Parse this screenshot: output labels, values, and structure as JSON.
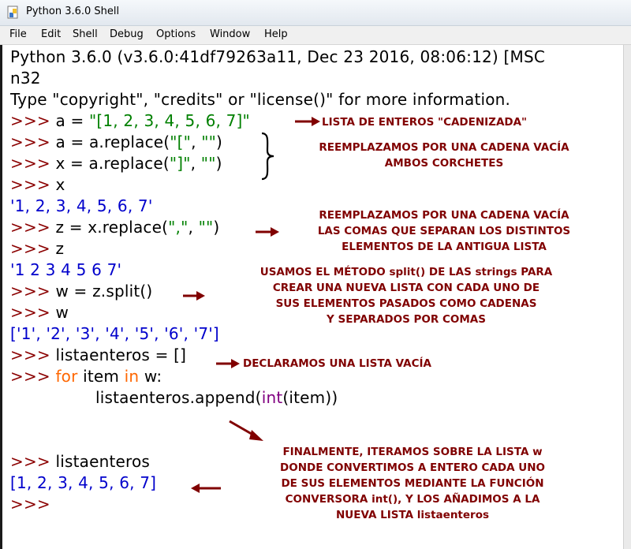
{
  "window": {
    "title": "Python 3.6.0 Shell"
  },
  "menu": [
    "File",
    "Edit",
    "Shell",
    "Debug",
    "Options",
    "Window",
    "Help"
  ],
  "shell": {
    "banner1": "Python 3.6.0 (v3.6.0:41df79263a11, Dec 23 2016, 08:06:12) [MSC",
    "banner2": "n32",
    "banner3": "Type \"copyright\", \"credits\" or \"license()\" for more information.",
    "prompt": ">>> ",
    "l4_code": "a = ",
    "l4_str": "\"[1, 2, 3, 4, 5, 6, 7]\"",
    "l5_a": "a = a.replace(",
    "l5_s1": "\"[\"",
    "l5_b": ", ",
    "l5_s2": "\"\"",
    "l5_c": ")",
    "l6_a": "x = a.replace(",
    "l6_s1": "\"]\"",
    "l6_b": ", ",
    "l6_s2": "\"\"",
    "l6_c": ")",
    "l7_code": "x",
    "l8_out": "'1, 2, 3, 4, 5, 6, 7'",
    "l9_a": "z = x.replace(",
    "l9_s1": "\",\"",
    "l9_b": ", ",
    "l9_s2": "\"\"",
    "l9_c": ")",
    "l10_code": "z",
    "l11_out": "'1 2 3 4 5 6 7'",
    "l12_code": "w = z.split()",
    "l13_code": "w",
    "l14_out": "['1', '2', '3', '4', '5', '6', '7']",
    "l15_code": "listaenteros = []",
    "l16_kw1": "for",
    "l16_mid": " item ",
    "l16_kw2": "in",
    "l16_end": " w:",
    "l17_a": "listaenteros.append(",
    "l17_bi": "int",
    "l17_c": "(item))",
    "l18_code": "listaenteros",
    "l19_out": "[1, 2, 3, 4, 5, 6, 7]",
    "l20_prompt": ">>>"
  },
  "annotations": {
    "n1": "LISTA DE ENTEROS \"CADENIZADA\"",
    "n2": "REEMPLAZAMOS POR UNA CADENA VACÍA\nAMBOS CORCHETES",
    "n3": "REEMPLAZAMOS POR UNA CADENA VACÍA\nLAS COMAS QUE SEPARAN LOS DISTINTOS\nELEMENTOS DE LA ANTIGUA LISTA",
    "n4": "USAMOS EL MÉTODO split() DE LAS strings PARA\nCREAR UNA NUEVA LISTA CON CADA UNO DE\nSUS ELEMENTOS PASADOS COMO CADENAS\nY SEPARADOS POR COMAS",
    "n5": "DECLARAMOS UNA LISTA VACÍA",
    "n6": "FINALMENTE, ITERAMOS SOBRE LA LISTA w\nDONDE CONVERTIMOS A ENTERO CADA UNO\nDE SUS ELEMENTOS MEDIANTE LA FUNCIÓN\nCONVERSORA int(), Y LOS AÑADIMOS A LA\nNUEVA LISTA listaenteros"
  },
  "colors": {
    "prompt": "#8b0000",
    "string": "#008000",
    "output": "#0000cc",
    "keyword": "#ff6600",
    "builtin": "#800080",
    "annotation": "#800000"
  }
}
